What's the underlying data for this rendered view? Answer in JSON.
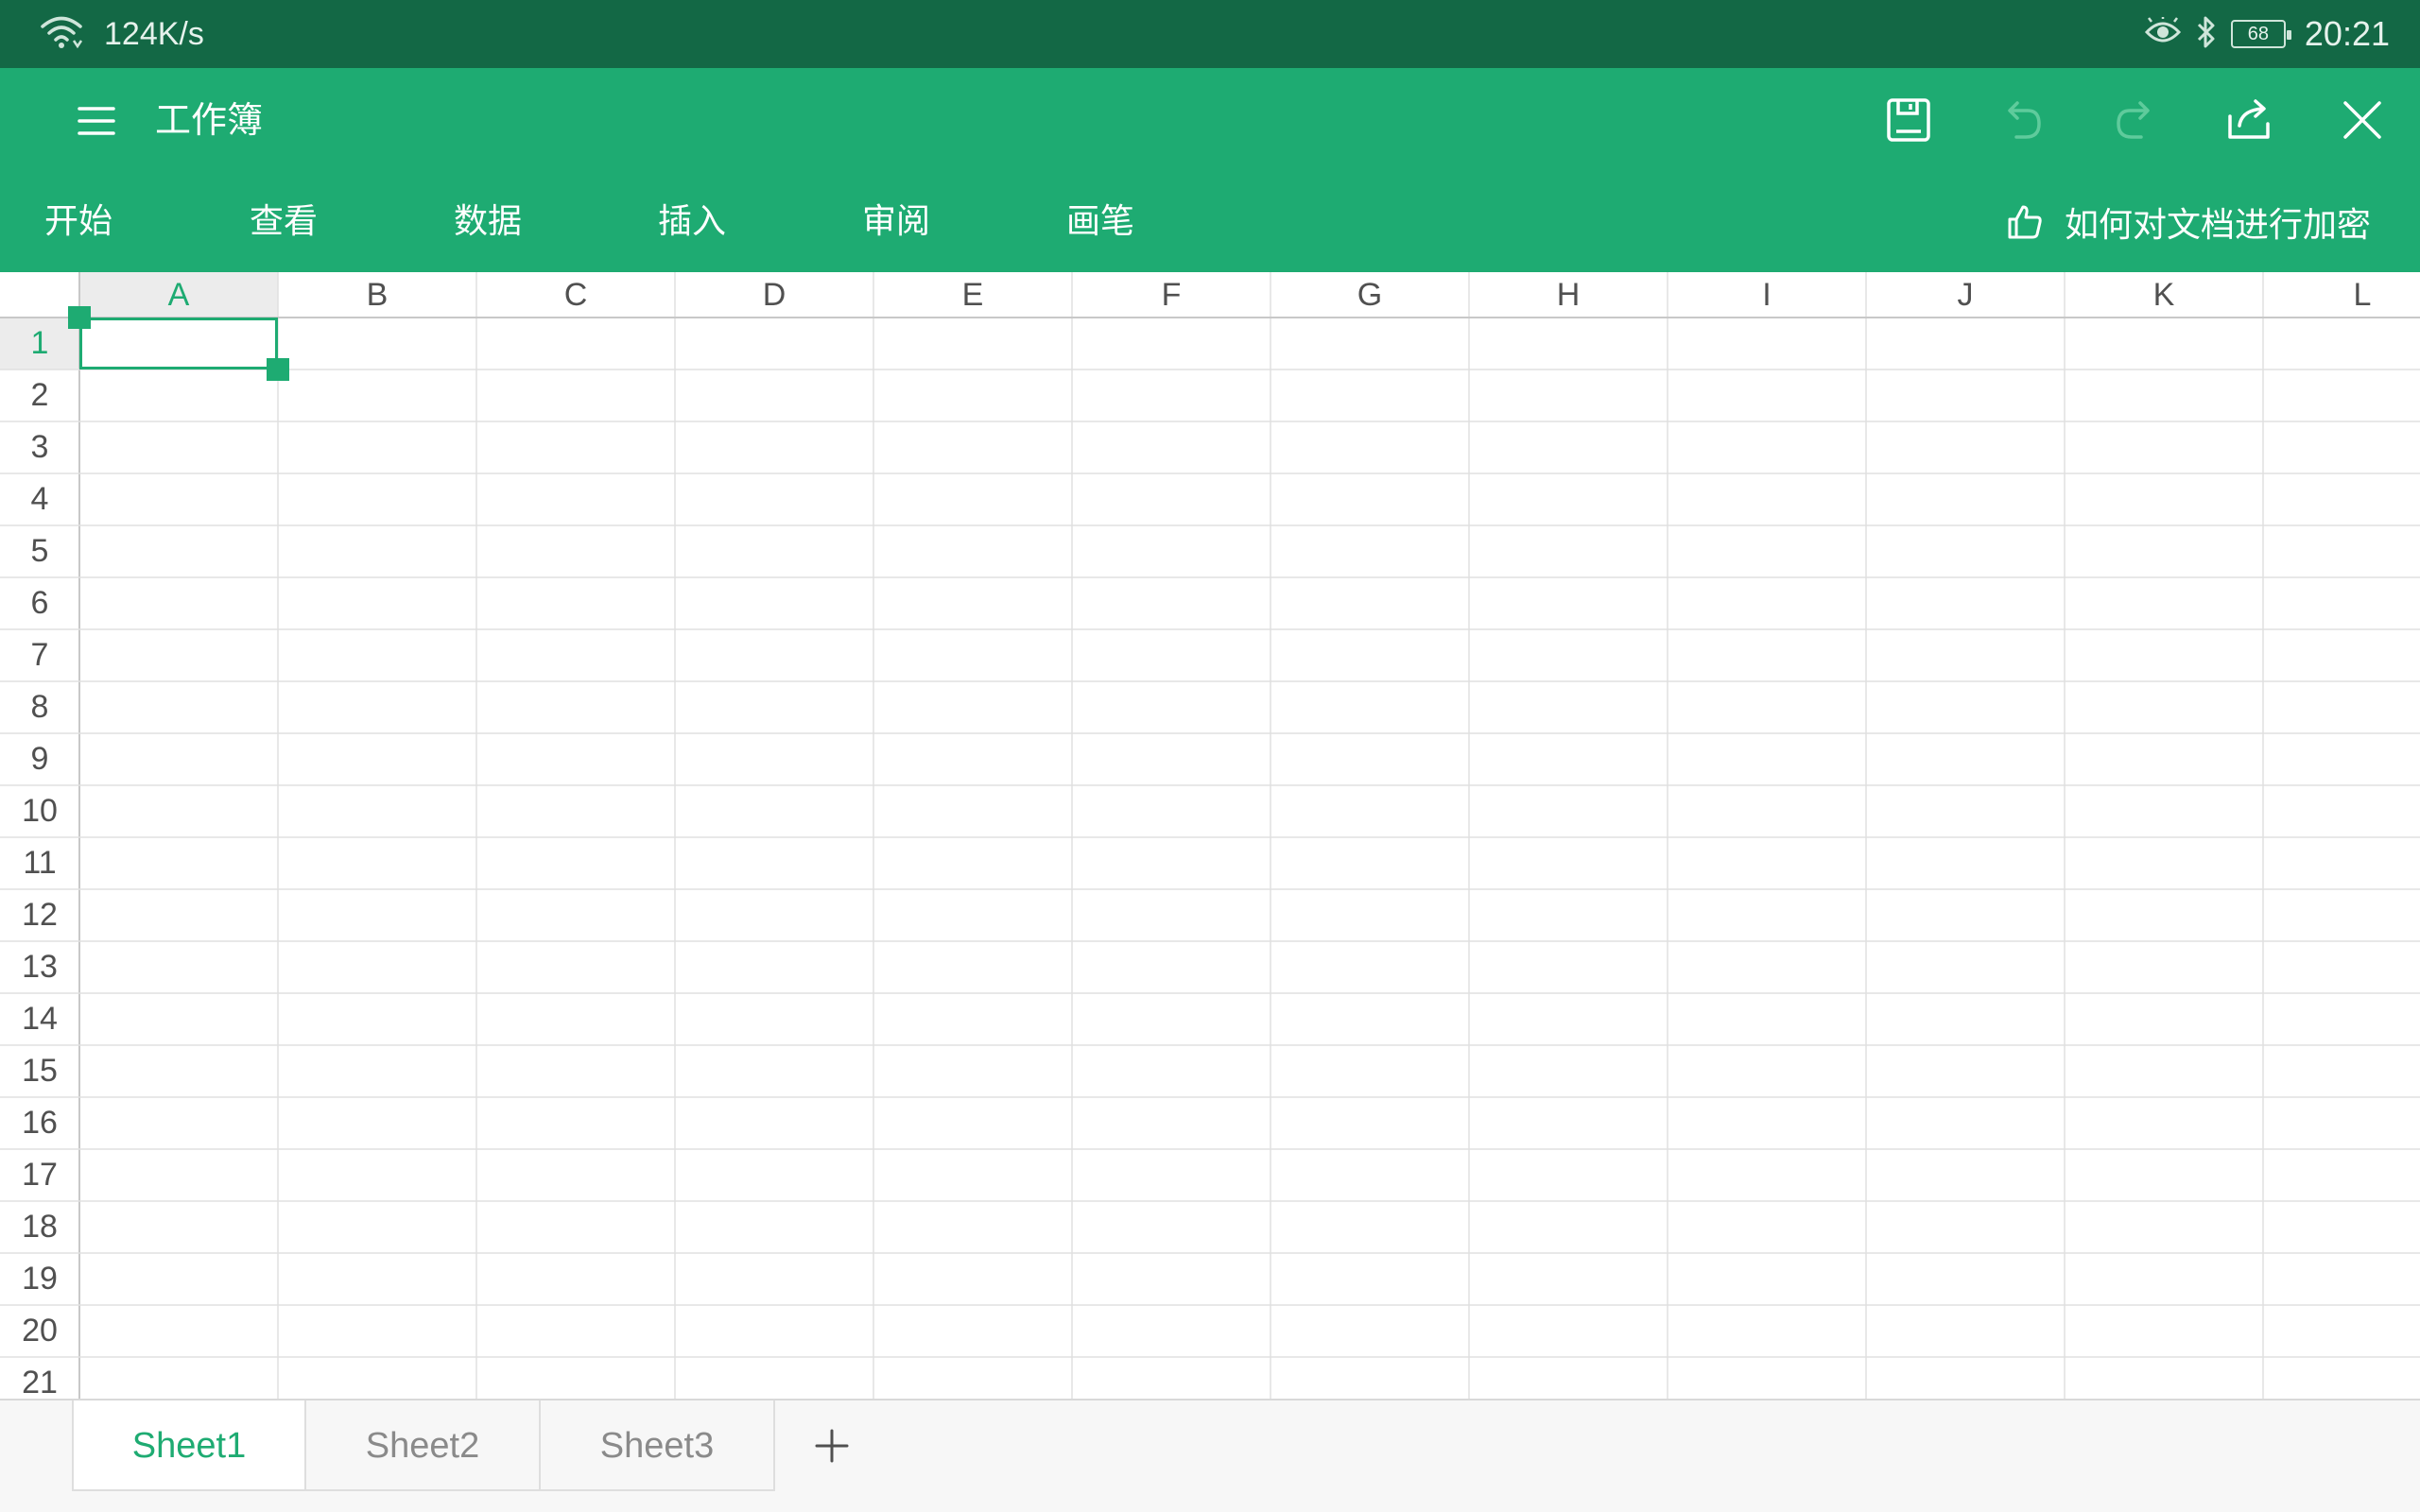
{
  "status_bar": {
    "network_speed": "124K/s",
    "battery_level": "68",
    "time": "20:21",
    "icons": [
      "wifi-icon",
      "eye-comfort-icon",
      "bluetooth-icon",
      "battery-icon"
    ]
  },
  "title_bar": {
    "title": "工作簿",
    "icons": [
      "menu-icon",
      "save-icon",
      "undo-icon",
      "redo-icon",
      "share-icon",
      "close-icon"
    ]
  },
  "ribbon": {
    "tabs": [
      "开始",
      "查看",
      "数据",
      "插入",
      "审阅",
      "画笔"
    ],
    "tip_text": "如何对文档进行加密",
    "tip_icon": "thumbs-up-icon"
  },
  "grid": {
    "columns": [
      "A",
      "B",
      "C",
      "D",
      "E",
      "F",
      "G",
      "H",
      "I",
      "J",
      "K",
      "L"
    ],
    "rows": [
      "1",
      "2",
      "3",
      "4",
      "5",
      "6",
      "7",
      "8",
      "9",
      "10",
      "11",
      "12",
      "13",
      "14",
      "15",
      "16",
      "17",
      "18",
      "19",
      "20",
      "21"
    ],
    "selected_cell": "A1"
  },
  "sheet_tabs": {
    "sheets": [
      "Sheet1",
      "Sheet2",
      "Sheet3"
    ],
    "active": "Sheet1",
    "add_label": "+"
  },
  "colors": {
    "status_bar": "#136845",
    "toolbar": "#1eab72",
    "accent": "#1eab72",
    "gridline": "#e0e0e0"
  }
}
